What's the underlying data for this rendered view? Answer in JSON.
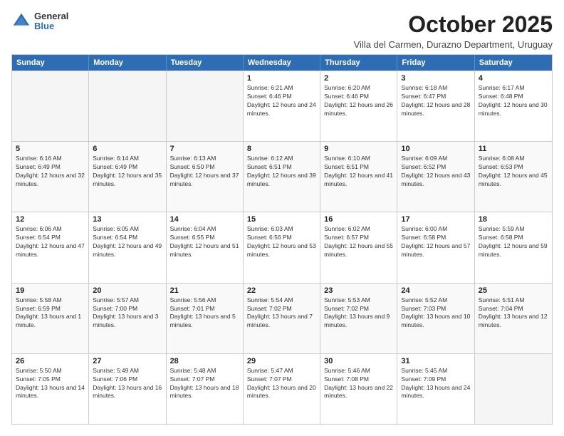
{
  "logo": {
    "general": "General",
    "blue": "Blue"
  },
  "header": {
    "month": "October 2025",
    "location": "Villa del Carmen, Durazno Department, Uruguay"
  },
  "days": [
    "Sunday",
    "Monday",
    "Tuesday",
    "Wednesday",
    "Thursday",
    "Friday",
    "Saturday"
  ],
  "weeks": [
    [
      {
        "day": "",
        "empty": true
      },
      {
        "day": "",
        "empty": true
      },
      {
        "day": "",
        "empty": true
      },
      {
        "day": "1",
        "sunrise": "6:21 AM",
        "sunset": "6:46 PM",
        "daylight": "12 hours and 24 minutes."
      },
      {
        "day": "2",
        "sunrise": "6:20 AM",
        "sunset": "6:46 PM",
        "daylight": "12 hours and 26 minutes."
      },
      {
        "day": "3",
        "sunrise": "6:18 AM",
        "sunset": "6:47 PM",
        "daylight": "12 hours and 28 minutes."
      },
      {
        "day": "4",
        "sunrise": "6:17 AM",
        "sunset": "6:48 PM",
        "daylight": "12 hours and 30 minutes."
      }
    ],
    [
      {
        "day": "5",
        "sunrise": "6:16 AM",
        "sunset": "6:49 PM",
        "daylight": "12 hours and 32 minutes."
      },
      {
        "day": "6",
        "sunrise": "6:14 AM",
        "sunset": "6:49 PM",
        "daylight": "12 hours and 35 minutes."
      },
      {
        "day": "7",
        "sunrise": "6:13 AM",
        "sunset": "6:50 PM",
        "daylight": "12 hours and 37 minutes."
      },
      {
        "day": "8",
        "sunrise": "6:12 AM",
        "sunset": "6:51 PM",
        "daylight": "12 hours and 39 minutes."
      },
      {
        "day": "9",
        "sunrise": "6:10 AM",
        "sunset": "6:51 PM",
        "daylight": "12 hours and 41 minutes."
      },
      {
        "day": "10",
        "sunrise": "6:09 AM",
        "sunset": "6:52 PM",
        "daylight": "12 hours and 43 minutes."
      },
      {
        "day": "11",
        "sunrise": "6:08 AM",
        "sunset": "6:53 PM",
        "daylight": "12 hours and 45 minutes."
      }
    ],
    [
      {
        "day": "12",
        "sunrise": "6:06 AM",
        "sunset": "6:54 PM",
        "daylight": "12 hours and 47 minutes."
      },
      {
        "day": "13",
        "sunrise": "6:05 AM",
        "sunset": "6:54 PM",
        "daylight": "12 hours and 49 minutes."
      },
      {
        "day": "14",
        "sunrise": "6:04 AM",
        "sunset": "6:55 PM",
        "daylight": "12 hours and 51 minutes."
      },
      {
        "day": "15",
        "sunrise": "6:03 AM",
        "sunset": "6:56 PM",
        "daylight": "12 hours and 53 minutes."
      },
      {
        "day": "16",
        "sunrise": "6:02 AM",
        "sunset": "6:57 PM",
        "daylight": "12 hours and 55 minutes."
      },
      {
        "day": "17",
        "sunrise": "6:00 AM",
        "sunset": "6:58 PM",
        "daylight": "12 hours and 57 minutes."
      },
      {
        "day": "18",
        "sunrise": "5:59 AM",
        "sunset": "6:58 PM",
        "daylight": "12 hours and 59 minutes."
      }
    ],
    [
      {
        "day": "19",
        "sunrise": "5:58 AM",
        "sunset": "6:59 PM",
        "daylight": "13 hours and 1 minute."
      },
      {
        "day": "20",
        "sunrise": "5:57 AM",
        "sunset": "7:00 PM",
        "daylight": "13 hours and 3 minutes."
      },
      {
        "day": "21",
        "sunrise": "5:56 AM",
        "sunset": "7:01 PM",
        "daylight": "13 hours and 5 minutes."
      },
      {
        "day": "22",
        "sunrise": "5:54 AM",
        "sunset": "7:02 PM",
        "daylight": "13 hours and 7 minutes."
      },
      {
        "day": "23",
        "sunrise": "5:53 AM",
        "sunset": "7:02 PM",
        "daylight": "13 hours and 9 minutes."
      },
      {
        "day": "24",
        "sunrise": "5:52 AM",
        "sunset": "7:03 PM",
        "daylight": "13 hours and 10 minutes."
      },
      {
        "day": "25",
        "sunrise": "5:51 AM",
        "sunset": "7:04 PM",
        "daylight": "13 hours and 12 minutes."
      }
    ],
    [
      {
        "day": "26",
        "sunrise": "5:50 AM",
        "sunset": "7:05 PM",
        "daylight": "13 hours and 14 minutes."
      },
      {
        "day": "27",
        "sunrise": "5:49 AM",
        "sunset": "7:06 PM",
        "daylight": "13 hours and 16 minutes."
      },
      {
        "day": "28",
        "sunrise": "5:48 AM",
        "sunset": "7:07 PM",
        "daylight": "13 hours and 18 minutes."
      },
      {
        "day": "29",
        "sunrise": "5:47 AM",
        "sunset": "7:07 PM",
        "daylight": "13 hours and 20 minutes."
      },
      {
        "day": "30",
        "sunrise": "5:46 AM",
        "sunset": "7:08 PM",
        "daylight": "13 hours and 22 minutes."
      },
      {
        "day": "31",
        "sunrise": "5:45 AM",
        "sunset": "7:09 PM",
        "daylight": "13 hours and 24 minutes."
      },
      {
        "day": "",
        "empty": true
      }
    ]
  ]
}
